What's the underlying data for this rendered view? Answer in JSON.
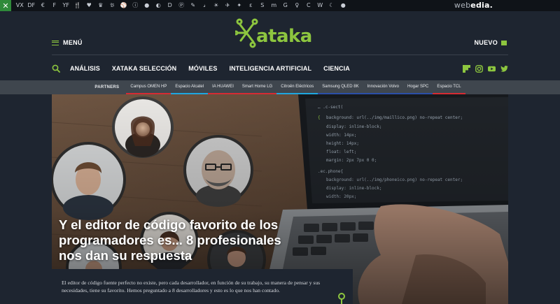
{
  "network_bar": {
    "home_icon": "xataka-x-icon",
    "sites": [
      "VX",
      "DF",
      "€",
      "F",
      "YF",
      "🍴",
      "♥",
      "♛",
      "𝔅",
      "⚾",
      "ⓘ",
      "●",
      "◐",
      "D",
      "Ⓟ",
      "✎",
      "𝓈",
      "☀",
      "✈",
      "✦",
      "ε",
      "S",
      "m",
      "G",
      "♀",
      "C",
      "W",
      "☾",
      "●"
    ],
    "brand_light": "web",
    "brand_bold": "edia."
  },
  "header": {
    "menu_label": "MENÚ",
    "logo_text": "Xataka",
    "nuevo_label": "NUEVO"
  },
  "nav": {
    "items": [
      "ANÁLISIS",
      "XATAKA SELECCIÓN",
      "MÓVILES",
      "INTELIGENCIA ARTIFICIAL",
      "CIENCIA"
    ],
    "social_icons": [
      "flipboard-icon",
      "instagram-icon",
      "youtube-icon",
      "twitter-icon"
    ]
  },
  "partners": {
    "label": "PARTNERS",
    "items": [
      {
        "label": "Campus OMEN HP",
        "color": "#d62b33"
      },
      {
        "label": "Espacio Alcatel",
        "color": "#1ea7e0"
      },
      {
        "label": "IA HUAWEI",
        "color": "#d62b33"
      },
      {
        "label": "Smart Home LG",
        "color": "#d62b33"
      },
      {
        "label": "Citroën Eléctricos",
        "color": "#1ea7e0"
      },
      {
        "label": "Samsung QLED 8K",
        "color": "#2b4fa8"
      },
      {
        "label": "Innovación Volvo",
        "color": "#2b4fa8"
      },
      {
        "label": "Hogar SPC",
        "color": "#2b4fa8"
      },
      {
        "label": "Espacio TCL",
        "color": "#d62b33"
      }
    ]
  },
  "hero": {
    "title": "Y el editor de código favorito de los programadores es... 8 profesionales nos dan su respuesta",
    "excerpt": "El editor de código fuente perfecto no existe, pero cada desarrollador, en función de su trabajo, su manera de pensar y sus necesidades, tiene su favorito. Hemos preguntado a 8 desarrolladores y esto es lo que nos han contado."
  },
  "colors": {
    "accent": "#8dc63f",
    "background": "#1e2530",
    "partners_bg": "#3f464e"
  }
}
